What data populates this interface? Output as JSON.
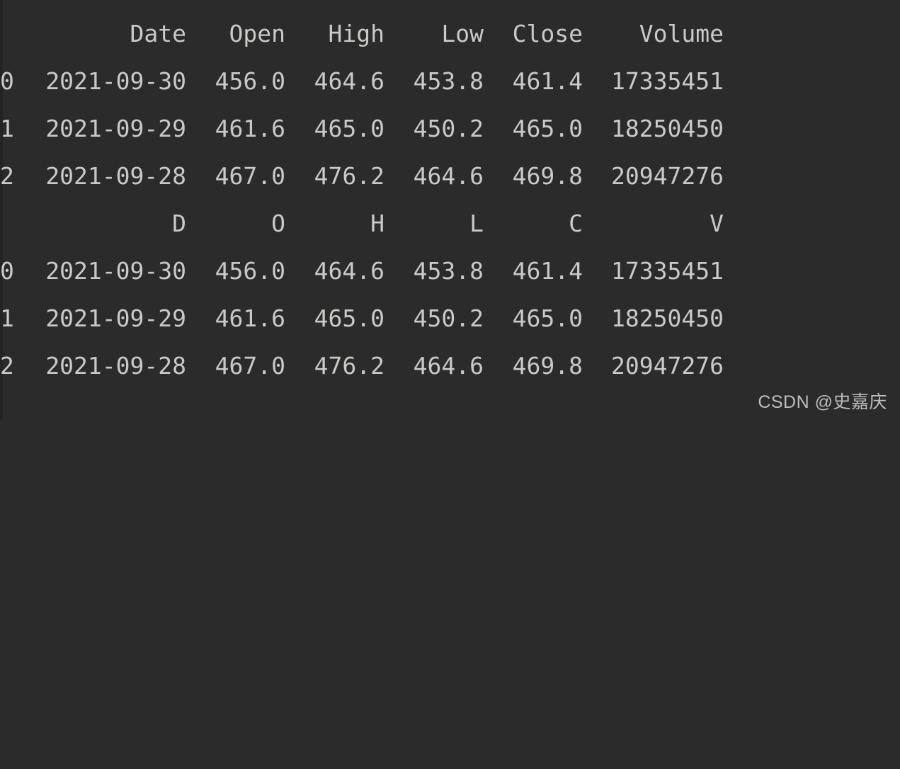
{
  "terminal": {
    "background_color": "#2b2b2b",
    "text_color": "#c9c9c6",
    "blocks": [
      {
        "name": "original-dataframe",
        "headers": {
          "index": "",
          "date": "Date",
          "open": "Open",
          "high": "High",
          "low": "Low",
          "close": "Close",
          "volume": "Volume"
        },
        "rows": [
          {
            "index": "0",
            "date": "2021-09-30",
            "open": "456.0",
            "high": "464.6",
            "low": "453.8",
            "close": "461.4",
            "volume": "17335451"
          },
          {
            "index": "1",
            "date": "2021-09-29",
            "open": "461.6",
            "high": "465.0",
            "low": "450.2",
            "close": "465.0",
            "volume": "18250450"
          },
          {
            "index": "2",
            "date": "2021-09-28",
            "open": "467.0",
            "high": "476.2",
            "low": "464.6",
            "close": "469.8",
            "volume": "20947276"
          }
        ]
      },
      {
        "name": "renamed-dataframe",
        "headers": {
          "index": "",
          "date": "D",
          "open": "O",
          "high": "H",
          "low": "L",
          "close": "C",
          "volume": "V"
        },
        "rows": [
          {
            "index": "0",
            "date": "2021-09-30",
            "open": "456.0",
            "high": "464.6",
            "low": "453.8",
            "close": "461.4",
            "volume": "17335451"
          },
          {
            "index": "1",
            "date": "2021-09-29",
            "open": "461.6",
            "high": "465.0",
            "low": "450.2",
            "close": "465.0",
            "volume": "18250450"
          },
          {
            "index": "2",
            "date": "2021-09-28",
            "open": "467.0",
            "high": "476.2",
            "low": "464.6",
            "close": "469.8",
            "volume": "20947276"
          }
        ]
      }
    ]
  },
  "watermark": {
    "text": "CSDN @史嘉庆"
  }
}
